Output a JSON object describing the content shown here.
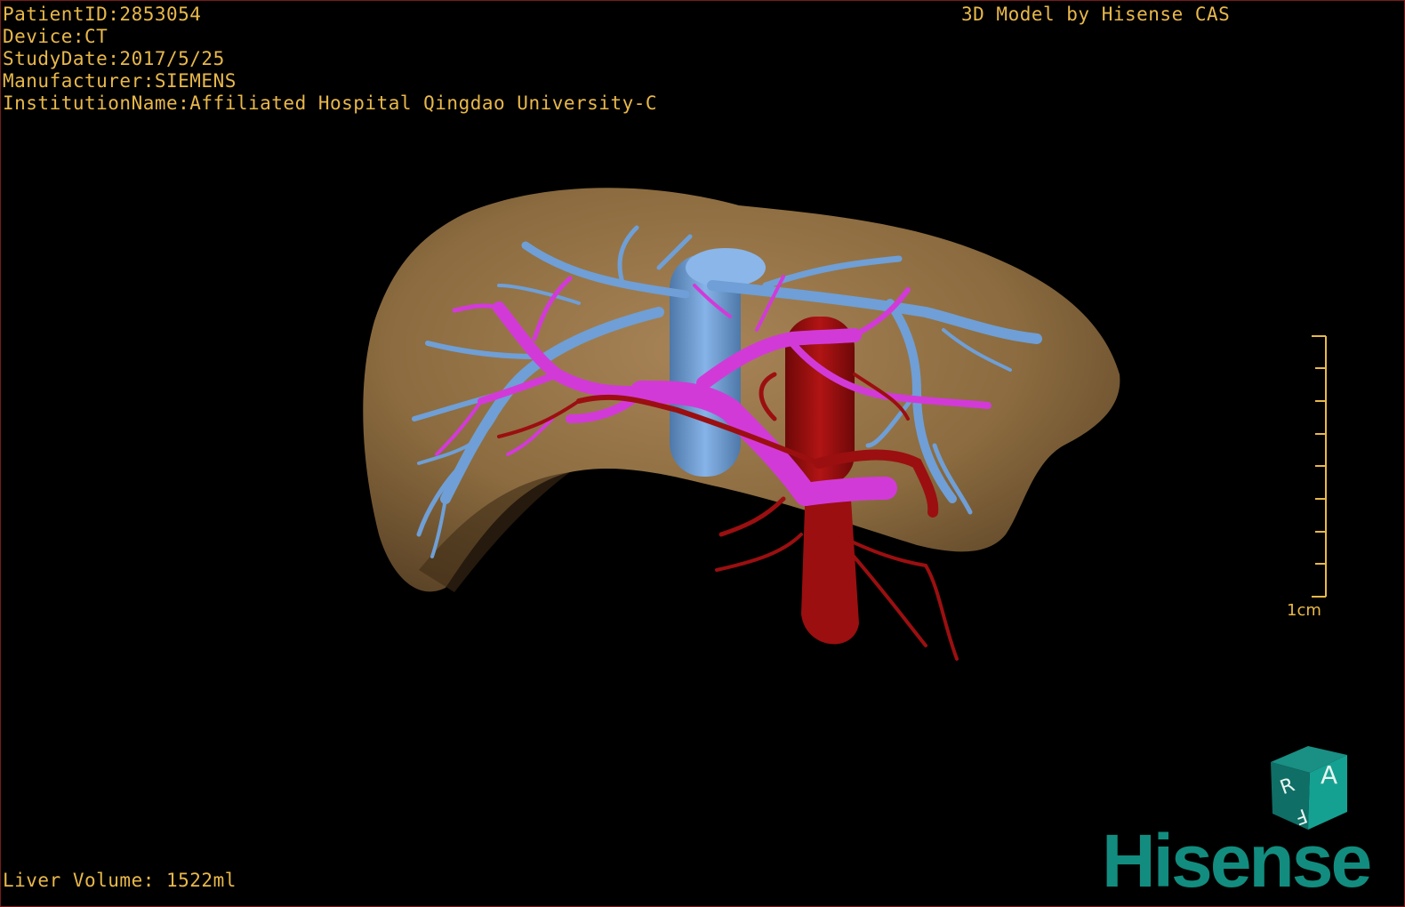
{
  "overlay": {
    "patient_id": "PatientID:2853054",
    "device": "Device:CT",
    "study_date": "StudyDate:2017/5/25",
    "manufacturer": "Manufacturer:SIEMENS",
    "institution": "InstitutionName:Affiliated Hospital Qingdao University-C",
    "model_credit": "3D Model by Hisense CAS",
    "liver_volume": "Liver Volume: 1522ml"
  },
  "scale_bar": {
    "label": "1cm"
  },
  "orientation_cube": {
    "face_top": "A",
    "face_left": "R",
    "face_right": "F"
  },
  "brand": {
    "logo_text": "Hisense"
  },
  "colors": {
    "background": "#000000",
    "overlay_text": "#e8b84a",
    "liver": "#8b6b3f",
    "hepatic_vein": "#6f9fd6",
    "portal_vein": "#d23ad8",
    "artery": "#9b0f10",
    "brand": "#128c7e"
  },
  "icons": {
    "orientation": "orientation-cube-icon",
    "scale": "scale-bar-icon"
  }
}
